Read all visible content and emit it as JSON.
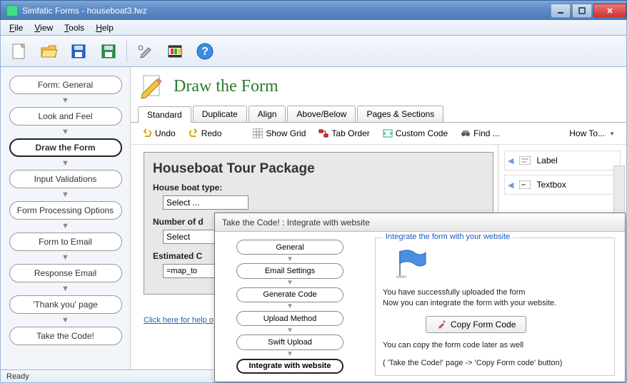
{
  "window": {
    "title": "Simfatic Forms - houseboat3.fwz"
  },
  "menu": {
    "file": "File",
    "view": "View",
    "tools": "Tools",
    "help": "Help"
  },
  "sidebar": [
    "Form: General",
    "Look and Feel",
    "Draw the Form",
    "Input Validations",
    "Form Processing Options",
    "Form to Email",
    "Response Email",
    "'Thank you' page",
    "Take the Code!"
  ],
  "sidebar_active": 2,
  "page": {
    "title": "Draw the Form"
  },
  "tabs": [
    "Standard",
    "Duplicate",
    "Align",
    "Above/Below",
    "Pages & Sections"
  ],
  "tabs_active": 0,
  "subtoolbar": {
    "undo": "Undo",
    "redo": "Redo",
    "showgrid": "Show Grid",
    "taborder": "Tab Order",
    "customcode": "Custom Code",
    "find": "Find ...",
    "howto": "How To..."
  },
  "preview": {
    "title": "Houseboat Tour Package",
    "label_boattype": "House boat type:",
    "select_boattype": "Select ...",
    "label_days": "Number of d",
    "select_days": "Select",
    "label_cost": "Estimated C",
    "input_cost": "=map_to",
    "help_link": "Click here for help o"
  },
  "palette": {
    "label": "Label",
    "textbox": "Textbox"
  },
  "dialog": {
    "title": "Take the Code! : Integrate with website",
    "steps": [
      "General",
      "Email Settings",
      "Generate Code",
      "Upload Method",
      "Swift Upload",
      "Integrate with website"
    ],
    "steps_active": 5,
    "fieldset_legend": "Integrate the form with your website",
    "line1": "You have successfully uploaded the form",
    "line2": "Now you can integrate the form with your website.",
    "copy_btn": "Copy Form Code",
    "line3": "You can copy the form code later as well",
    "line4": "( 'Take the Code!' page -> 'Copy Form code' button)"
  },
  "status": "Ready"
}
